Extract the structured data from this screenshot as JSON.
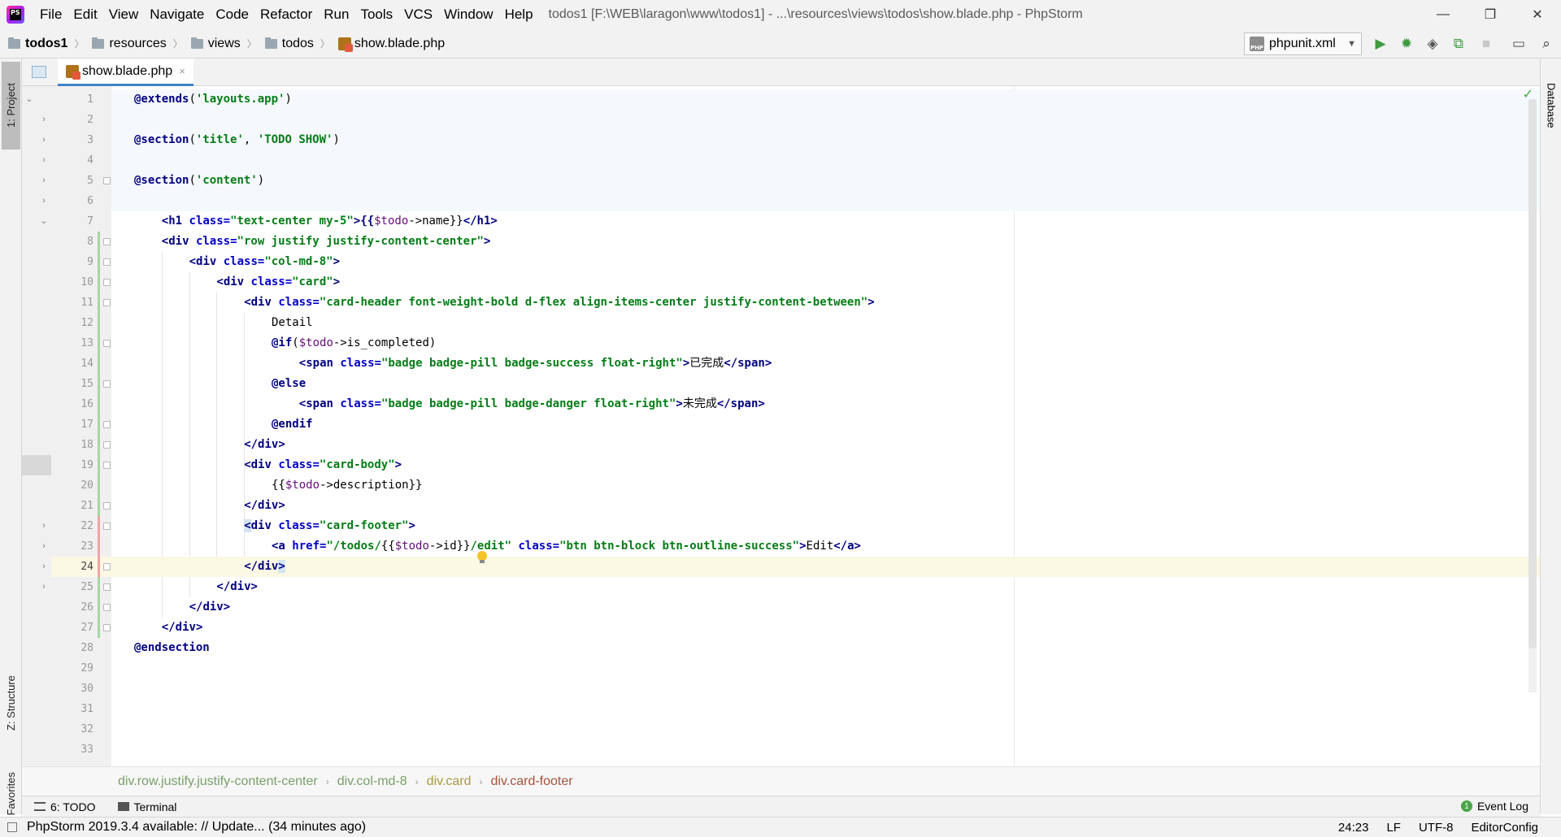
{
  "app": {
    "window_title": "todos1 [F:\\WEB\\laragon\\www\\todos1] - ...\\resources\\views\\todos\\show.blade.php - PhpStorm",
    "logo_text": "PS"
  },
  "menu": [
    "File",
    "Edit",
    "View",
    "Navigate",
    "Code",
    "Refactor",
    "Run",
    "Tools",
    "VCS",
    "Window",
    "Help"
  ],
  "window_controls": {
    "minimize": "—",
    "restore": "❐",
    "close": "✕"
  },
  "navbar": {
    "crumbs": [
      "todos1",
      "resources",
      "views",
      "todos",
      "show.blade.php"
    ],
    "run_config": "phpunit.xml",
    "run_config_icon_text": "PHP"
  },
  "left_tools": {
    "project": "1: Project",
    "structure": "Z: Structure",
    "favorites": "2: Favorites"
  },
  "right_tools": {
    "database": "Database"
  },
  "editor_tab": {
    "label": "show.blade.php",
    "close": "×"
  },
  "editor": {
    "current_line": 24,
    "line_numbers": [
      1,
      2,
      3,
      4,
      5,
      6,
      7,
      8,
      9,
      10,
      11,
      12,
      13,
      14,
      15,
      16,
      17,
      18,
      19,
      20,
      21,
      22,
      23,
      24,
      25,
      26,
      27,
      28,
      29,
      30,
      31,
      32,
      33
    ]
  },
  "code": {
    "l1_dir": "@extends",
    "l1_open": "(",
    "l1_str": "'layouts.app'",
    "l1_close": ")",
    "l3_dir": "@section",
    "l3_open": "(",
    "l3_s1": "'title'",
    "l3_comma": ", ",
    "l3_s2": "'TODO SHOW'",
    "l3_close": ")",
    "l5_dir": "@section",
    "l5_open": "(",
    "l5_str": "'content'",
    "l5_close": ")",
    "l7_a": "<h1 ",
    "l7_attr": "class=",
    "l7_val": "\"text-center my-5\"",
    "l7_b": ">{{",
    "l7_var": "$todo",
    "l7_arrow": "->",
    "l7_prop": "name",
    "l7_c": "}}",
    "l7_end": "</h1>",
    "l8_a": "<div ",
    "l8_attr": "class=",
    "l8_val": "\"row justify justify-content-center\"",
    "l8_end": ">",
    "l9_a": "<div ",
    "l9_attr": "class=",
    "l9_val": "\"col-md-8\"",
    "l9_end": ">",
    "l10_a": "<div ",
    "l10_attr": "class=",
    "l10_val": "\"card\"",
    "l10_end": ">",
    "l11_a": "<div ",
    "l11_attr": "class=",
    "l11_val": "\"card-header font-weight-bold d-flex align-items-center justify-content-between\"",
    "l11_end": ">",
    "l12_txt": "Detail",
    "l13_dir": "@if",
    "l13_open": "(",
    "l13_var": "$todo",
    "l13_arrow": "->",
    "l13_prop": "is_completed",
    "l13_close": ")",
    "l14_a": "<span ",
    "l14_attr": "class=",
    "l14_val": "\"badge badge-pill badge-success float-right\"",
    "l14_b": ">",
    "l14_txt": "已完成",
    "l14_end": "</span>",
    "l15_dir": "@else",
    "l16_a": "<span ",
    "l16_attr": "class=",
    "l16_val": "\"badge badge-pill badge-danger float-right\"",
    "l16_b": ">",
    "l16_txt": "未完成",
    "l16_end": "</span>",
    "l17_dir": "@endif",
    "l18_end": "</div>",
    "l19_a": "<div ",
    "l19_attr": "class=",
    "l19_val": "\"card-body\"",
    "l19_end": ">",
    "l20_a": "{{",
    "l20_var": "$todo",
    "l20_arrow": "->",
    "l20_prop": "description",
    "l20_b": "}}",
    "l21_end": "</div>",
    "l22_lt": "<",
    "l22_a": "div ",
    "l22_attr": "class=",
    "l22_val": "\"card-footer\"",
    "l22_end": ">",
    "l23_a": "<a ",
    "l23_attr1": "href=",
    "l23_val1a": "\"/todos/",
    "l23_mid": "{{",
    "l23_var": "$todo",
    "l23_arrow": "->",
    "l23_prop": "id",
    "l23_mid2": "}}",
    "l23_val1b": "/edit\"",
    "l23_sp": " ",
    "l23_attr2": "class=",
    "l23_val2": "\"btn btn-block btn-outline-success\"",
    "l23_b": ">",
    "l23_txt": "Edit",
    "l23_end": "</a>",
    "l24_a": "</div",
    "l24_gt": ">",
    "l25_end": "</div>",
    "l26_end": "</div>",
    "l27_end": "</div>",
    "l28_dir": "@endsection"
  },
  "html_path": [
    "div.row.justify.justify-content-center",
    "div.col-md-8",
    "div.card",
    "div.card-footer"
  ],
  "toolwindows": {
    "todo": "6: TODO",
    "terminal": "Terminal",
    "event_log": "Event Log"
  },
  "status": {
    "message": "PhpStorm 2019.3.4 available: // Update... (34 minutes ago)",
    "position": "24:23",
    "line_sep": "LF",
    "encoding": "UTF-8",
    "editorconfig": "EditorConfig"
  },
  "colors": {
    "accent": "#4083c9",
    "directive": "#000080",
    "string": "#067d17",
    "attribute": "#0000c8",
    "variable": "#660e7a"
  }
}
